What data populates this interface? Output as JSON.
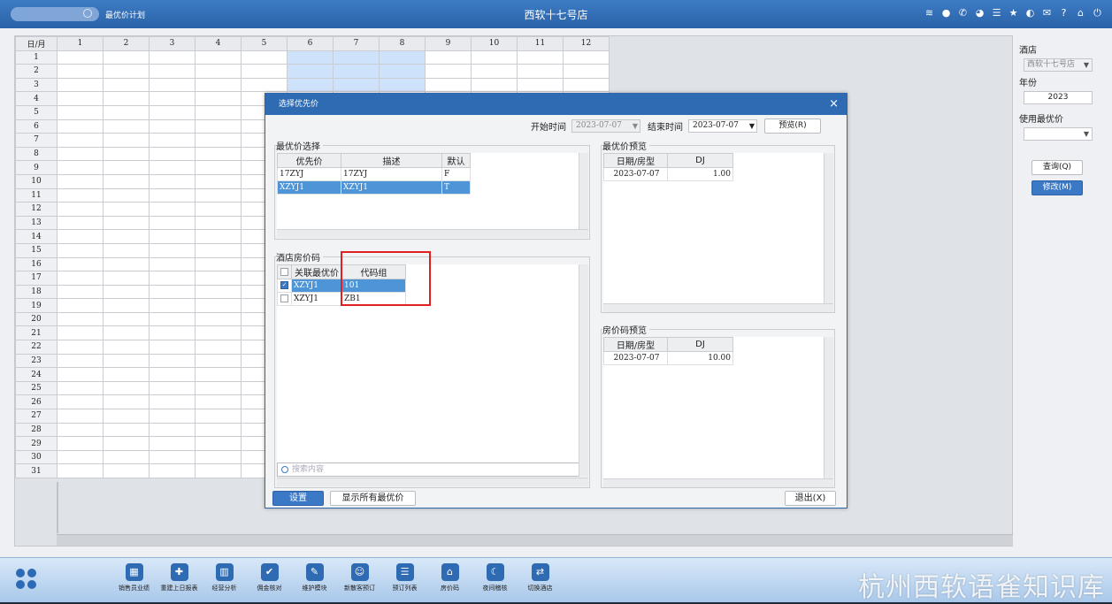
{
  "titlebar": {
    "module_name": "最优价计划",
    "hotel_title": "西软十七号店",
    "icons": [
      "wifi-icon",
      "message-icon",
      "phone-icon",
      "palette-icon",
      "menu-icon",
      "star-icon",
      "moon-icon",
      "mail-icon",
      "help-icon",
      "home-icon",
      "power-icon"
    ]
  },
  "grid": {
    "corner": "日/月",
    "months": [
      "1",
      "2",
      "3",
      "4",
      "5",
      "6",
      "7",
      "8",
      "9",
      "10",
      "11",
      "12"
    ],
    "days": [
      "1",
      "2",
      "3",
      "4",
      "5",
      "6",
      "7",
      "8",
      "9",
      "10",
      "11",
      "12",
      "13",
      "14",
      "15",
      "16",
      "17",
      "18",
      "19",
      "20",
      "21",
      "22",
      "23",
      "24",
      "25",
      "26",
      "27",
      "28",
      "29",
      "30",
      "31"
    ],
    "selected_months": [
      "6",
      "7",
      "8"
    ],
    "selected_days_to": 3
  },
  "right_panel": {
    "hotel_label": "酒店",
    "hotel_value": "西软十七号店",
    "year_label": "年份",
    "year_value": "2023",
    "use_label": "使用最优价",
    "use_value": "",
    "query_button": "查询(Q)",
    "modify_button": "修改(M)"
  },
  "dialog": {
    "title": "选择优先价",
    "start_label": "开始时间",
    "start_value": "2023-07-07",
    "end_label": "结束时间",
    "end_value": "2023-07-07",
    "preview_button": "预览(R)",
    "best_price_select": {
      "title": "最优价选择",
      "headers": [
        "优先价",
        "描述",
        "默认"
      ],
      "rows": [
        [
          "17ZYJ",
          "17ZYJ",
          "F"
        ],
        [
          "XZYJ1",
          "XZYJ1",
          "T"
        ]
      ]
    },
    "room_code": {
      "title": "酒店房价码",
      "headers": [
        "关联最优价",
        "代码组"
      ],
      "rows": [
        [
          "XZYJ1",
          "101"
        ],
        [
          "XZYJ1",
          "ZB1"
        ]
      ],
      "checked": [
        true,
        false
      ]
    },
    "search_placeholder": "搜索内容",
    "best_preview": {
      "title": "最优价预览",
      "headers": [
        "日期/房型",
        "DJ"
      ],
      "rows": [
        [
          "2023-07-07",
          "1.00"
        ]
      ]
    },
    "code_preview": {
      "title": "房价码预览",
      "headers": [
        "日期/房型",
        "DJ"
      ],
      "rows": [
        [
          "2023-07-07",
          "10.00"
        ]
      ]
    },
    "set_button": "设置",
    "show_all_button": "显示所有最优价",
    "exit_button": "退出(X)"
  },
  "taskbar": {
    "tools": [
      {
        "label": "销售员业绩",
        "icon": "chart-icon",
        "glyph": "▦"
      },
      {
        "label": "重建上日报表",
        "icon": "report-add-icon",
        "glyph": "✚"
      },
      {
        "label": "经营分析",
        "icon": "bar-chart-icon",
        "glyph": "▥"
      },
      {
        "label": "佣金核对",
        "icon": "check-icon",
        "glyph": "✔"
      },
      {
        "label": "维护模块",
        "icon": "wrench-icon",
        "glyph": "✎"
      },
      {
        "label": "新散客预订",
        "icon": "guest-icon",
        "glyph": "☺"
      },
      {
        "label": "预订列表",
        "icon": "list-icon",
        "glyph": "☰"
      },
      {
        "label": "房价码",
        "icon": "house-icon",
        "glyph": "⌂"
      },
      {
        "label": "夜间稽核",
        "icon": "night-icon",
        "glyph": "☾"
      },
      {
        "label": "切换酒店",
        "icon": "switch-icon",
        "glyph": "⇄"
      }
    ],
    "watermark": "杭州西软语雀知识库"
  }
}
